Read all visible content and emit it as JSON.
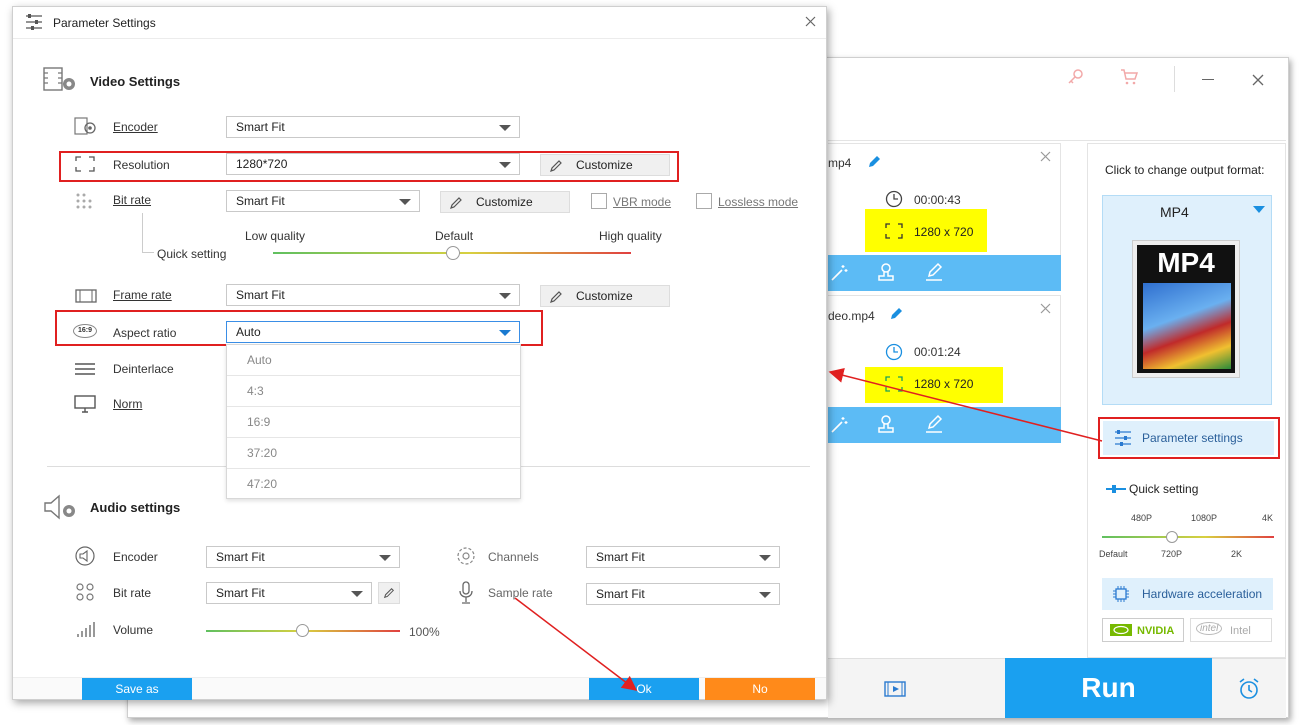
{
  "dialog": {
    "title": "Parameter Settings",
    "video_section_title": "Video Settings",
    "audio_section_title": "Audio settings",
    "video": {
      "encoder": {
        "label": "Encoder",
        "value": "Smart Fit"
      },
      "resolution": {
        "label": "Resolution",
        "value": "1280*720",
        "button": "Customize"
      },
      "bitrate": {
        "label": "Bit rate",
        "value": "Smart Fit",
        "button": "Customize",
        "vbr": "VBR mode",
        "lossless": "Lossless mode"
      },
      "quick_setting": {
        "label": "Quick setting",
        "low": "Low quality",
        "default": "Default",
        "high": "High quality",
        "level": 0.5
      },
      "framerate": {
        "label": "Frame rate",
        "value": "Smart Fit",
        "button": "Customize"
      },
      "aspect": {
        "label": "Aspect ratio",
        "value": "Auto",
        "options": [
          "Auto",
          "4:3",
          "16:9",
          "37:20",
          "47:20"
        ]
      },
      "deinterlace": {
        "label": "Deinterlace"
      },
      "norm": {
        "label": "Norm"
      }
    },
    "audio": {
      "encoder": {
        "label": "Encoder",
        "value": "Smart Fit"
      },
      "bitrate": {
        "label": "Bit rate",
        "value": "Smart Fit"
      },
      "volume": {
        "label": "Volume",
        "value": "100%",
        "level": 0.48
      },
      "channels": {
        "label": "Channels",
        "value": "Smart Fit"
      },
      "samplerate": {
        "label": "Sample rate",
        "value": "Smart Fit"
      }
    },
    "buttons": {
      "save_as": "Save as",
      "ok": "Ok",
      "no": "No"
    }
  },
  "main_window": {
    "files": [
      {
        "name": "mp4",
        "duration": "00:00:43",
        "resolution": "1280 x 720"
      },
      {
        "name": "deo.mp4",
        "duration": "00:01:24",
        "resolution": "1280 x 720"
      }
    ],
    "format_panel": {
      "hint": "Click to change output format:",
      "format": "MP4",
      "thumb_text": "MP4",
      "param_button": "Parameter settings",
      "quick_setting": "Quick setting",
      "scale_top": [
        "480P",
        "1080P",
        "4K"
      ],
      "scale_bottom": [
        "Default",
        "720P",
        "2K"
      ],
      "hw_accel": "Hardware acceleration",
      "nvidia": "NVIDIA",
      "intel": "Intel"
    },
    "run_button": "Run"
  },
  "colors": {
    "accent_blue": "#1aa0f0",
    "orange": "#ff8a1a",
    "highlight": "#ffff00",
    "annotation_red": "#e02020"
  }
}
